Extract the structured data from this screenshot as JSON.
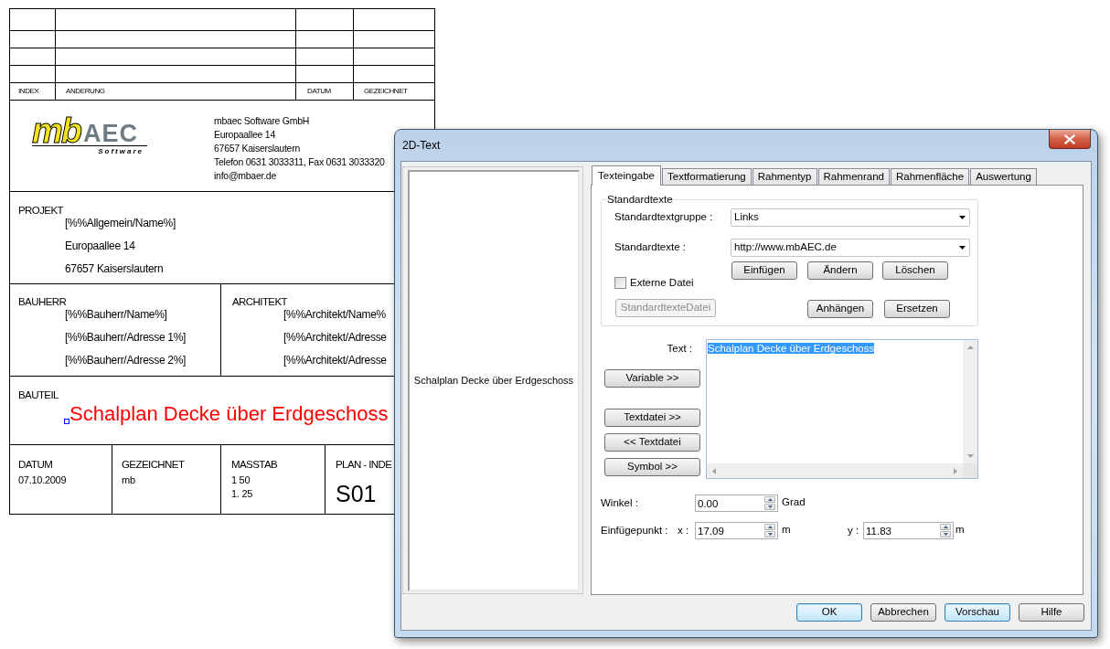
{
  "drawing": {
    "revisions": {
      "columns": [
        "INDEX",
        "ANDERUNG",
        "DATUM",
        "GEZEICHNET"
      ]
    },
    "company": {
      "logo": {
        "mark": "mb",
        "name": "AEC",
        "tagline": "Software"
      },
      "lines": [
        "mbaec Software GmbH",
        "Europaallee 14",
        "67657 Kaiserslautern",
        "Telefon 0631 3033311, Fax 0631 3033320",
        "info@mbaer.de"
      ]
    },
    "project": {
      "label": "PROJEKT",
      "lines": [
        "[%%Allgemein/Name%]",
        "Europaallee 14",
        "67657 Kaiserslautern"
      ]
    },
    "client": {
      "label": "BAUHERR",
      "lines": [
        "[%%Bauherr/Name%]",
        "[%%Bauherr/Adresse 1%]",
        "[%%Bauherr/Adresse 2%]"
      ]
    },
    "architect": {
      "label": "ARCHITEKT",
      "lines": [
        "[%%Architekt/Name%",
        "[%%Architekt/Adresse",
        "[%%Architekt/Adresse"
      ]
    },
    "component": {
      "label": "BAUTEIL",
      "title": "Schalplan Decke über Erdgeschoss"
    },
    "footer": [
      {
        "label": "DATUM",
        "kind": "small",
        "values": [
          "07.10.2009"
        ]
      },
      {
        "label": "GEZEICHNET",
        "kind": "small",
        "values": [
          "mb"
        ]
      },
      {
        "label": "MASSTAB",
        "kind": "small",
        "values": [
          "1 50",
          "1. 25"
        ]
      },
      {
        "label": "PLAN - INDE",
        "kind": "large",
        "values": [
          "S01"
        ]
      }
    ]
  },
  "dialog": {
    "title": "2D-Text",
    "preview": "Schalplan Decke über Erdgeschoss",
    "tabs": [
      {
        "label": "Texteingabe",
        "selected": true
      },
      {
        "label": "Textformatierung",
        "selected": false
      },
      {
        "label": "Rahmentyp",
        "selected": false
      },
      {
        "label": "Rahmenrand",
        "selected": false
      },
      {
        "label": "Rahmenfläche",
        "selected": false
      },
      {
        "label": "Auswertung",
        "selected": false
      }
    ],
    "standard_texts": {
      "legend": "Standardtexte",
      "group": {
        "label": "Standardtextgruppe :",
        "value": "Links"
      },
      "text": {
        "label": "Standardtexte :",
        "value": "http://www.mbAEC.de"
      },
      "buttons": [
        "Einfügen",
        "Ändern",
        "Löschen"
      ],
      "external_file": {
        "label": "Externe Datei",
        "checked": false
      },
      "file_button": {
        "label": "StandardtexteDatei",
        "disabled": true
      },
      "more_buttons": [
        "Anhängen",
        "Ersetzen"
      ]
    },
    "text": {
      "label": "Text :",
      "value": "Schalplan Decke über Erdgeschoss",
      "selected": true
    },
    "side_buttons": [
      "Variable >>",
      "Textdatei >>",
      "<< Textdatei",
      "Symbol >>"
    ],
    "angle": {
      "label": "Winkel :",
      "value": "0.00",
      "unit": "Grad"
    },
    "insertion_point": {
      "label": "Einfügepunkt :",
      "x": {
        "label": "x :",
        "value": "17.09",
        "unit": "m"
      },
      "y": {
        "label": "y :",
        "value": "11.83",
        "unit": "m"
      }
    },
    "buttons": [
      {
        "label": "OK",
        "highlighted": true
      },
      {
        "label": "Abbrechen",
        "highlighted": false
      },
      {
        "label": "Vorschau",
        "highlighted": true
      },
      {
        "label": "Hilfe",
        "highlighted": false
      }
    ]
  }
}
